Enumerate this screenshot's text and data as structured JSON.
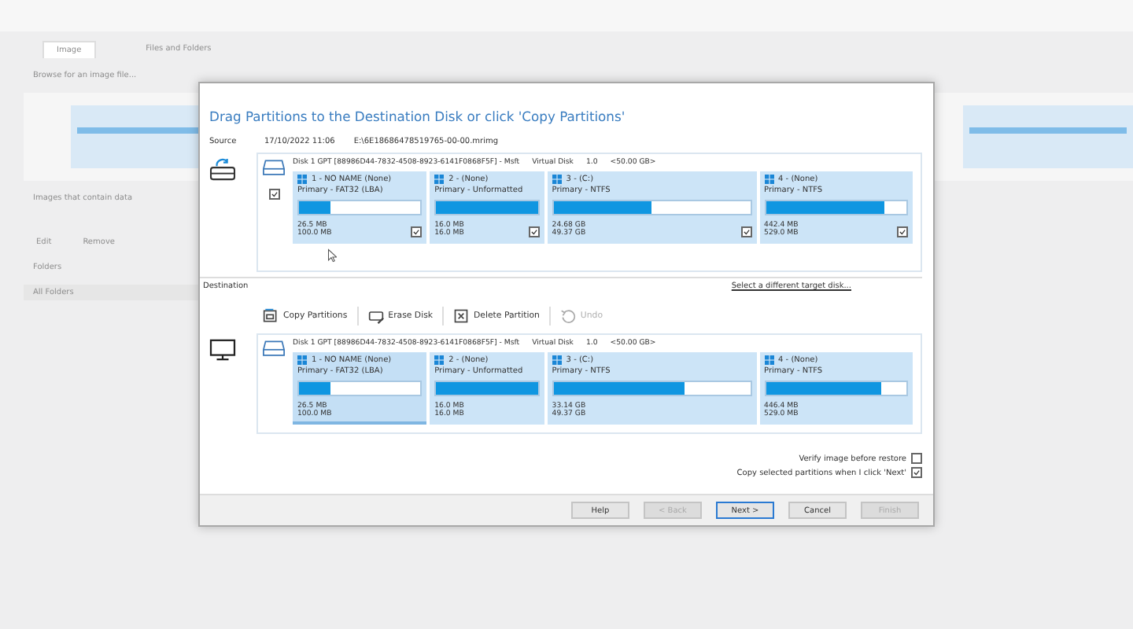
{
  "background": {
    "tabs": [
      {
        "label": "Image",
        "selected": true
      },
      {
        "label": "Files and Folders",
        "selected": false
      }
    ],
    "browse": "Browse for an image file...",
    "images_label": "Images that contain data",
    "toolbar": [
      "Edit",
      "Remove"
    ],
    "folders_label": "Folders",
    "folders_item": "All Folders"
  },
  "dialog": {
    "title": "Drag Partitions to the Destination Disk or click 'Copy Partitions'",
    "source": {
      "label": "Source",
      "date": "17/10/2022 11:06",
      "file": "E:\\6E18686478519765-00-00.mrimg",
      "disk": {
        "name": "Disk 1 GPT [88986D44-7832-4508-8923-6141F0868F5F] - Msft",
        "type": "Virtual Disk",
        "version": "1.0",
        "size": "<50.00 GB>",
        "checked": true,
        "partitions": [
          {
            "name": "1 - NO NAME (None)",
            "type": "Primary - FAT32 (LBA)",
            "level": 0.26,
            "used": "26.5 MB",
            "total": "100.0 MB",
            "checked": true
          },
          {
            "name": "2 - (None)",
            "type": "Primary - Unformatted",
            "level": 1.0,
            "used": "16.0 MB",
            "total": "16.0 MB",
            "checked": true
          },
          {
            "name": "3 - (C:)",
            "type": "Primary - NTFS",
            "level": 0.5,
            "used": "24.68 GB",
            "total": "49.37 GB",
            "checked": true
          },
          {
            "name": "4 - (None)",
            "type": "Primary - NTFS",
            "level": 0.84,
            "used": "442.4 MB",
            "total": "529.0 MB",
            "checked": true
          }
        ]
      }
    },
    "destination": {
      "label": "Destination",
      "link": "Select a different target disk...",
      "toolbar": [
        {
          "label": "Copy Partitions",
          "kind": "copy",
          "disabled": false
        },
        {
          "label": "Erase Disk",
          "kind": "erase",
          "disabled": false
        },
        {
          "label": "Delete Partition",
          "kind": "delete",
          "disabled": false
        },
        {
          "label": "Undo",
          "kind": "undo",
          "disabled": true
        }
      ],
      "disk": {
        "name": "Disk 1 GPT [88986D44-7832-4508-8923-6141F0868F5F] - Msft",
        "type": "Virtual Disk",
        "version": "1.0",
        "size": "<50.00 GB>",
        "partitions": [
          {
            "name": "1 - NO NAME (None)",
            "type": "Primary - FAT32 (LBA)",
            "level": 0.26,
            "used": "26.5 MB",
            "total": "100.0 MB",
            "selected": true
          },
          {
            "name": "2 - (None)",
            "type": "Primary - Unformatted",
            "level": 1.0,
            "used": "16.0 MB",
            "total": "16.0 MB",
            "selected": false
          },
          {
            "name": "3 - (C:)",
            "type": "Primary - NTFS",
            "level": 0.67,
            "used": "33.14 GB",
            "total": "49.37 GB",
            "selected": false
          },
          {
            "name": "4 - (None)",
            "type": "Primary - NTFS",
            "level": 0.82,
            "used": "446.4 MB",
            "total": "529.0 MB",
            "selected": false
          }
        ]
      }
    },
    "options": [
      {
        "label": "Verify image before restore",
        "checked": false
      },
      {
        "label": "Copy selected partitions when I click 'Next'",
        "checked": true
      }
    ],
    "buttons": [
      {
        "label": "Help",
        "disabled": false,
        "default": false
      },
      {
        "label": "< Back",
        "disabled": true,
        "default": false
      },
      {
        "label": "Next >",
        "disabled": false,
        "default": true
      },
      {
        "label": "Cancel",
        "disabled": false,
        "default": false
      },
      {
        "label": "Finish",
        "disabled": true,
        "default": false
      }
    ]
  }
}
